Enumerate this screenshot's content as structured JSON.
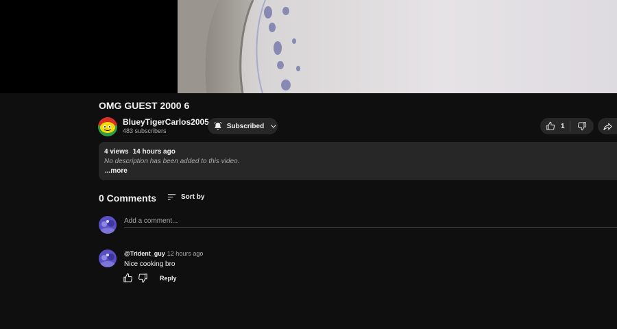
{
  "video": {
    "title": "OMG GUEST 2000 6"
  },
  "channel": {
    "name": "BlueyTigerCarlos2005",
    "subscribers": "483 subscribers",
    "subscribe_label": "Subscribed"
  },
  "actions": {
    "like_count": "1"
  },
  "description": {
    "views": "4 views",
    "age": "14 hours ago",
    "text": "No description has been added to this video.",
    "more_label": "...more"
  },
  "comments": {
    "count_label": "0 Comments",
    "sort_label": "Sort by",
    "add_placeholder": "Add a comment...",
    "items": [
      {
        "author": "@Trident_guy",
        "time": "12 hours ago",
        "text": "Nice cooking bro",
        "reply_label": "Reply"
      }
    ]
  },
  "colors": {
    "background": "#0f0f0f",
    "surface": "#272727",
    "text": "#f1f1f1",
    "muted": "#aaaaaa",
    "avatar_purple": "#5a4fc4"
  }
}
